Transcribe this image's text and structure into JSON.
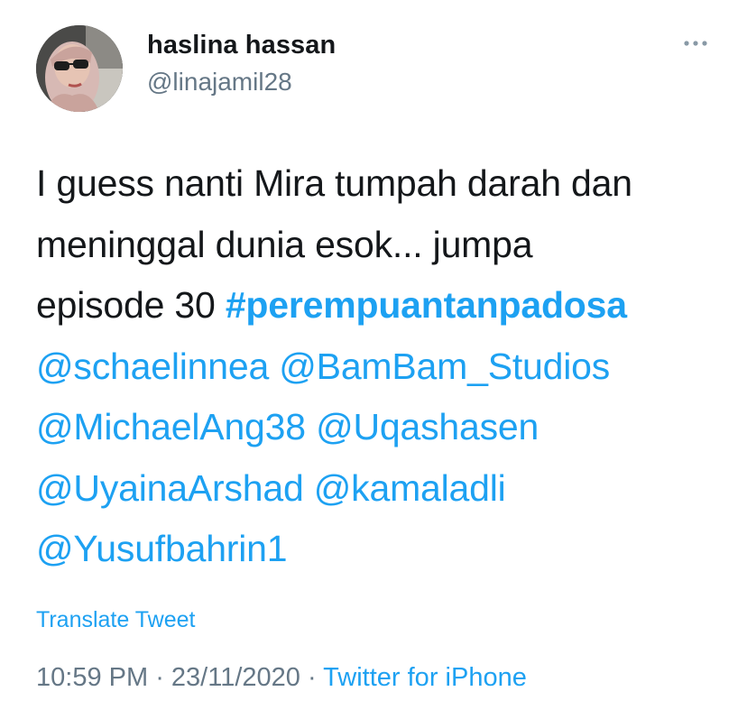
{
  "author": {
    "display_name": "haslina hassan",
    "handle": "@linajamil28"
  },
  "icons": {
    "avatar": "profile-photo",
    "more": "more-horizontal-icon"
  },
  "tweet": {
    "lines": [
      {
        "text": "I guess nanti Mira tumpah darah dan"
      },
      {
        "text": "meninggal dunia esok... jumpa"
      },
      {
        "prefix": "episode 30 ",
        "hashtag": "#perempuantanpadosa"
      },
      {
        "mentions": [
          "@schaelinnea",
          "@BamBam_Studios"
        ]
      },
      {
        "mentions": [
          "@MichaelAng38",
          "@Uqashasen"
        ]
      },
      {
        "mentions": [
          "@UyainaArshad",
          "@kamaladli"
        ]
      },
      {
        "mentions": [
          "@Yusufbahrin1"
        ]
      }
    ]
  },
  "translate_label": "Translate Tweet",
  "meta": {
    "time": "10:59 PM",
    "separator": " · ",
    "date": "23/11/2020",
    "source": "Twitter for iPhone"
  },
  "colors": {
    "link": "#1da1f2",
    "text": "#14171a",
    "secondary": "#657786"
  }
}
